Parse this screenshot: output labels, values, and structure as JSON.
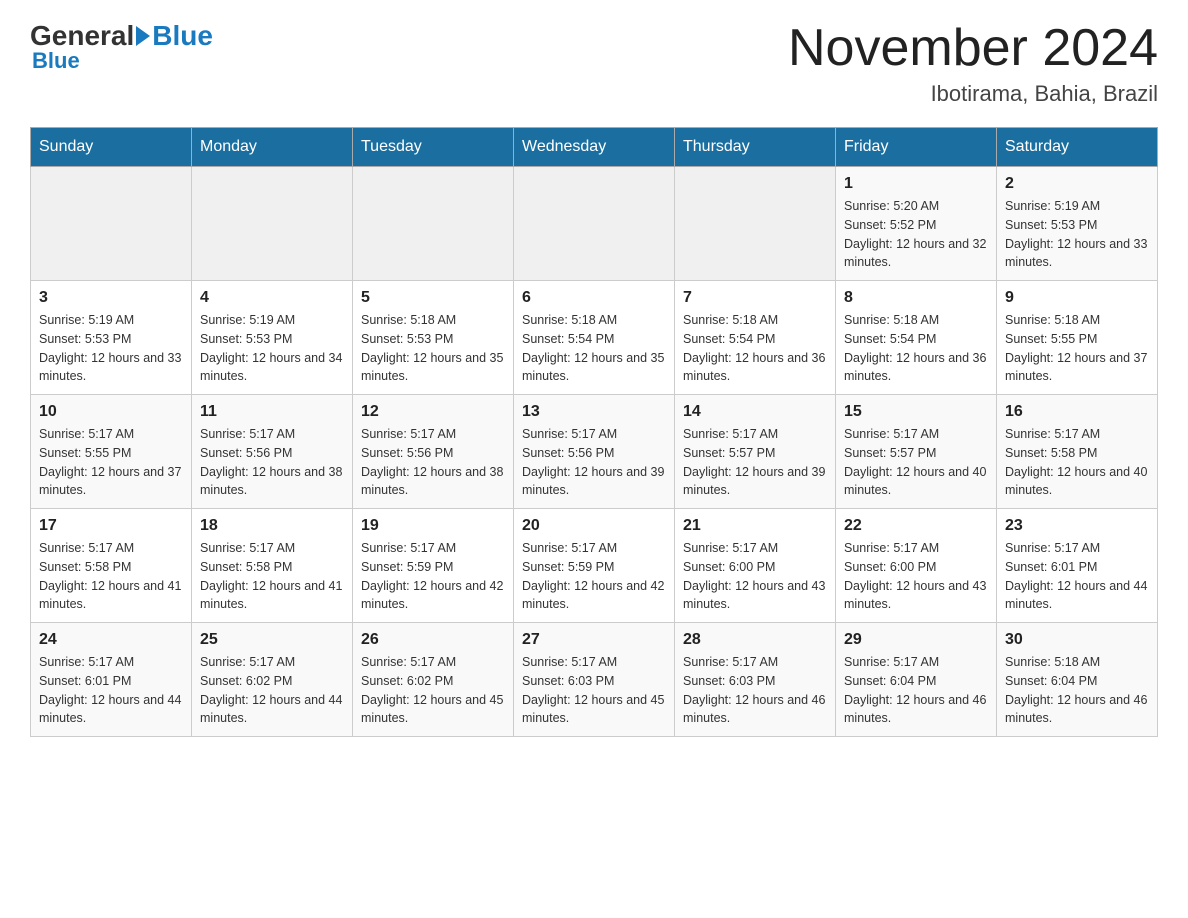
{
  "header": {
    "logo_general": "General",
    "logo_blue": "Blue",
    "month_title": "November 2024",
    "location": "Ibotirama, Bahia, Brazil"
  },
  "weekdays": [
    "Sunday",
    "Monday",
    "Tuesday",
    "Wednesday",
    "Thursday",
    "Friday",
    "Saturday"
  ],
  "weeks": [
    [
      {
        "day": "",
        "sunrise": "",
        "sunset": "",
        "daylight": "",
        "empty": true
      },
      {
        "day": "",
        "sunrise": "",
        "sunset": "",
        "daylight": "",
        "empty": true
      },
      {
        "day": "",
        "sunrise": "",
        "sunset": "",
        "daylight": "",
        "empty": true
      },
      {
        "day": "",
        "sunrise": "",
        "sunset": "",
        "daylight": "",
        "empty": true
      },
      {
        "day": "",
        "sunrise": "",
        "sunset": "",
        "daylight": "",
        "empty": true
      },
      {
        "day": "1",
        "sunrise": "Sunrise: 5:20 AM",
        "sunset": "Sunset: 5:52 PM",
        "daylight": "Daylight: 12 hours and 32 minutes.",
        "empty": false
      },
      {
        "day": "2",
        "sunrise": "Sunrise: 5:19 AM",
        "sunset": "Sunset: 5:53 PM",
        "daylight": "Daylight: 12 hours and 33 minutes.",
        "empty": false
      }
    ],
    [
      {
        "day": "3",
        "sunrise": "Sunrise: 5:19 AM",
        "sunset": "Sunset: 5:53 PM",
        "daylight": "Daylight: 12 hours and 33 minutes.",
        "empty": false
      },
      {
        "day": "4",
        "sunrise": "Sunrise: 5:19 AM",
        "sunset": "Sunset: 5:53 PM",
        "daylight": "Daylight: 12 hours and 34 minutes.",
        "empty": false
      },
      {
        "day": "5",
        "sunrise": "Sunrise: 5:18 AM",
        "sunset": "Sunset: 5:53 PM",
        "daylight": "Daylight: 12 hours and 35 minutes.",
        "empty": false
      },
      {
        "day": "6",
        "sunrise": "Sunrise: 5:18 AM",
        "sunset": "Sunset: 5:54 PM",
        "daylight": "Daylight: 12 hours and 35 minutes.",
        "empty": false
      },
      {
        "day": "7",
        "sunrise": "Sunrise: 5:18 AM",
        "sunset": "Sunset: 5:54 PM",
        "daylight": "Daylight: 12 hours and 36 minutes.",
        "empty": false
      },
      {
        "day": "8",
        "sunrise": "Sunrise: 5:18 AM",
        "sunset": "Sunset: 5:54 PM",
        "daylight": "Daylight: 12 hours and 36 minutes.",
        "empty": false
      },
      {
        "day": "9",
        "sunrise": "Sunrise: 5:18 AM",
        "sunset": "Sunset: 5:55 PM",
        "daylight": "Daylight: 12 hours and 37 minutes.",
        "empty": false
      }
    ],
    [
      {
        "day": "10",
        "sunrise": "Sunrise: 5:17 AM",
        "sunset": "Sunset: 5:55 PM",
        "daylight": "Daylight: 12 hours and 37 minutes.",
        "empty": false
      },
      {
        "day": "11",
        "sunrise": "Sunrise: 5:17 AM",
        "sunset": "Sunset: 5:56 PM",
        "daylight": "Daylight: 12 hours and 38 minutes.",
        "empty": false
      },
      {
        "day": "12",
        "sunrise": "Sunrise: 5:17 AM",
        "sunset": "Sunset: 5:56 PM",
        "daylight": "Daylight: 12 hours and 38 minutes.",
        "empty": false
      },
      {
        "day": "13",
        "sunrise": "Sunrise: 5:17 AM",
        "sunset": "Sunset: 5:56 PM",
        "daylight": "Daylight: 12 hours and 39 minutes.",
        "empty": false
      },
      {
        "day": "14",
        "sunrise": "Sunrise: 5:17 AM",
        "sunset": "Sunset: 5:57 PM",
        "daylight": "Daylight: 12 hours and 39 minutes.",
        "empty": false
      },
      {
        "day": "15",
        "sunrise": "Sunrise: 5:17 AM",
        "sunset": "Sunset: 5:57 PM",
        "daylight": "Daylight: 12 hours and 40 minutes.",
        "empty": false
      },
      {
        "day": "16",
        "sunrise": "Sunrise: 5:17 AM",
        "sunset": "Sunset: 5:58 PM",
        "daylight": "Daylight: 12 hours and 40 minutes.",
        "empty": false
      }
    ],
    [
      {
        "day": "17",
        "sunrise": "Sunrise: 5:17 AM",
        "sunset": "Sunset: 5:58 PM",
        "daylight": "Daylight: 12 hours and 41 minutes.",
        "empty": false
      },
      {
        "day": "18",
        "sunrise": "Sunrise: 5:17 AM",
        "sunset": "Sunset: 5:58 PM",
        "daylight": "Daylight: 12 hours and 41 minutes.",
        "empty": false
      },
      {
        "day": "19",
        "sunrise": "Sunrise: 5:17 AM",
        "sunset": "Sunset: 5:59 PM",
        "daylight": "Daylight: 12 hours and 42 minutes.",
        "empty": false
      },
      {
        "day": "20",
        "sunrise": "Sunrise: 5:17 AM",
        "sunset": "Sunset: 5:59 PM",
        "daylight": "Daylight: 12 hours and 42 minutes.",
        "empty": false
      },
      {
        "day": "21",
        "sunrise": "Sunrise: 5:17 AM",
        "sunset": "Sunset: 6:00 PM",
        "daylight": "Daylight: 12 hours and 43 minutes.",
        "empty": false
      },
      {
        "day": "22",
        "sunrise": "Sunrise: 5:17 AM",
        "sunset": "Sunset: 6:00 PM",
        "daylight": "Daylight: 12 hours and 43 minutes.",
        "empty": false
      },
      {
        "day": "23",
        "sunrise": "Sunrise: 5:17 AM",
        "sunset": "Sunset: 6:01 PM",
        "daylight": "Daylight: 12 hours and 44 minutes.",
        "empty": false
      }
    ],
    [
      {
        "day": "24",
        "sunrise": "Sunrise: 5:17 AM",
        "sunset": "Sunset: 6:01 PM",
        "daylight": "Daylight: 12 hours and 44 minutes.",
        "empty": false
      },
      {
        "day": "25",
        "sunrise": "Sunrise: 5:17 AM",
        "sunset": "Sunset: 6:02 PM",
        "daylight": "Daylight: 12 hours and 44 minutes.",
        "empty": false
      },
      {
        "day": "26",
        "sunrise": "Sunrise: 5:17 AM",
        "sunset": "Sunset: 6:02 PM",
        "daylight": "Daylight: 12 hours and 45 minutes.",
        "empty": false
      },
      {
        "day": "27",
        "sunrise": "Sunrise: 5:17 AM",
        "sunset": "Sunset: 6:03 PM",
        "daylight": "Daylight: 12 hours and 45 minutes.",
        "empty": false
      },
      {
        "day": "28",
        "sunrise": "Sunrise: 5:17 AM",
        "sunset": "Sunset: 6:03 PM",
        "daylight": "Daylight: 12 hours and 46 minutes.",
        "empty": false
      },
      {
        "day": "29",
        "sunrise": "Sunrise: 5:17 AM",
        "sunset": "Sunset: 6:04 PM",
        "daylight": "Daylight: 12 hours and 46 minutes.",
        "empty": false
      },
      {
        "day": "30",
        "sunrise": "Sunrise: 5:18 AM",
        "sunset": "Sunset: 6:04 PM",
        "daylight": "Daylight: 12 hours and 46 minutes.",
        "empty": false
      }
    ]
  ]
}
